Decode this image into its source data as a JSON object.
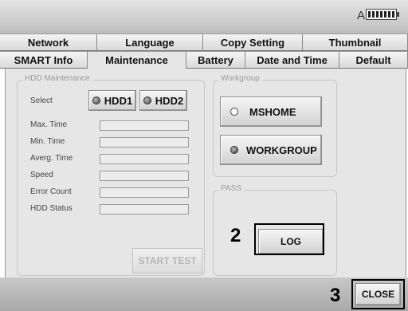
{
  "status": {
    "mode_letter": "A",
    "battery_icon": "battery-icon"
  },
  "tabs_row1": [
    "Network",
    "Language",
    "Copy Setting",
    "Thumbnail"
  ],
  "tabs_row2": [
    "SMART Info",
    "Maintenance",
    "Battery",
    "Date and Time",
    "Default"
  ],
  "active_tab": "Maintenance",
  "hdd_maintenance": {
    "title": "HDD Maintenance",
    "select_label": "Select",
    "hdd1_label": "HDD1",
    "hdd2_label": "HDD2",
    "fields": [
      {
        "label": "Max. Time",
        "value": ""
      },
      {
        "label": "Min. Time",
        "value": ""
      },
      {
        "label": "Averg. Time",
        "value": ""
      },
      {
        "label": "Speed",
        "value": ""
      },
      {
        "label": "Error Count",
        "value": ""
      },
      {
        "label": "HDD Status",
        "value": ""
      }
    ],
    "start_test_label": "START TEST"
  },
  "workgroup": {
    "title": "Workgroup",
    "mshome_label": "MSHOME",
    "workgroup_label": "WORKGROUP"
  },
  "pass": {
    "title": "PASS",
    "log_label": "LOG"
  },
  "callouts": {
    "log": "2",
    "close": "3"
  },
  "close_label": "CLOSE"
}
